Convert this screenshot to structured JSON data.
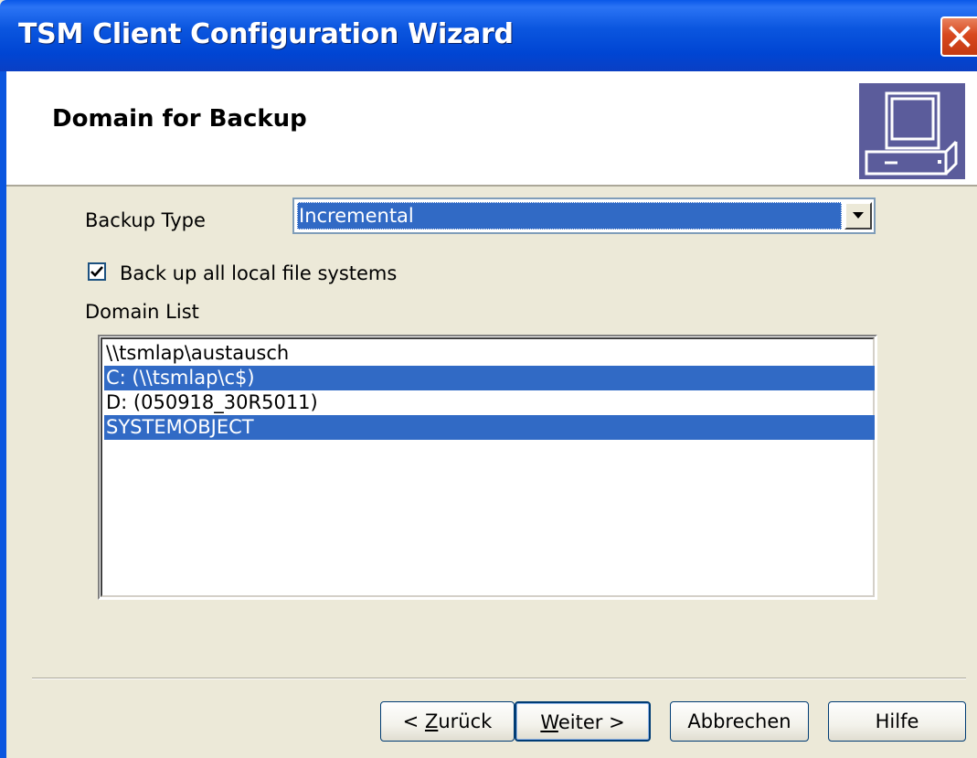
{
  "window": {
    "title": "TSM Client Configuration Wizard"
  },
  "header": {
    "title": "Domain for Backup",
    "icon": "computer-icon"
  },
  "backup_type": {
    "label": "Backup Type",
    "value": "Incremental"
  },
  "local_fs": {
    "label": "Back up all local file systems",
    "checked": true
  },
  "domain_list": {
    "label": "Domain List",
    "items": [
      {
        "text": "\\\\tsmlap\\austausch",
        "selected": false
      },
      {
        "text": "C: (\\\\tsmlap\\c$)",
        "selected": true
      },
      {
        "text": "D: (050918_30R5011)",
        "selected": false
      },
      {
        "text": "SYSTEMOBJECT",
        "selected": true
      }
    ]
  },
  "buttons": {
    "back": {
      "mnemonic": "Z",
      "rest": "urück",
      "prefix": "< "
    },
    "next": {
      "mnemonic": "W",
      "rest": "eiter",
      "suffix": " >"
    },
    "cancel": "Abbrechen",
    "help": "Hilfe"
  },
  "colors": {
    "titlebar": "#0054e3",
    "selection": "#316ac5",
    "dialog": "#ece9d8",
    "close": "#d8481f"
  }
}
